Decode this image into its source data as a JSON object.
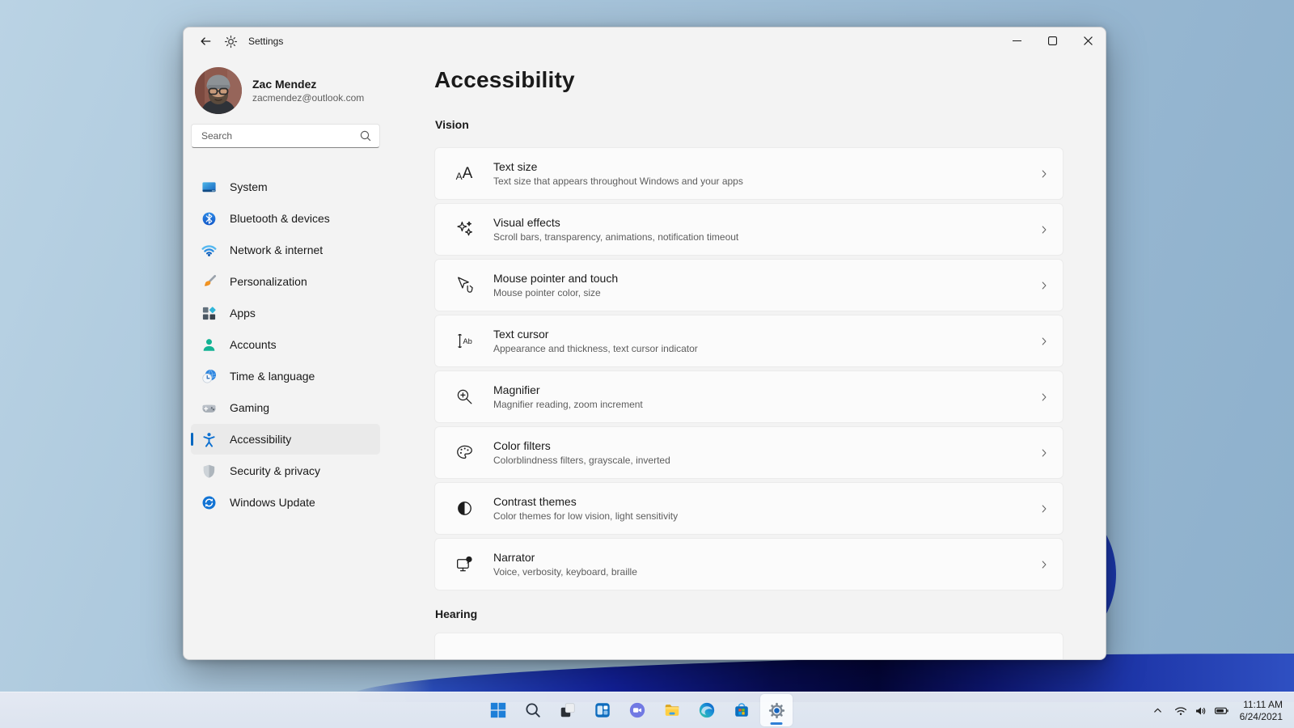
{
  "titlebar": {
    "app_title": "Settings",
    "icons": [
      "back-arrow-icon",
      "settings-gear-icon",
      "minimize-icon",
      "maximize-icon",
      "close-icon"
    ]
  },
  "profile": {
    "name": "Zac Mendez",
    "email": "zacmendez@outlook.com",
    "avatar": "user-photo"
  },
  "search": {
    "placeholder": "Search",
    "icon": "search-icon"
  },
  "sidebar": {
    "items": [
      {
        "label": "System",
        "icon": "system-icon",
        "selected": false
      },
      {
        "label": "Bluetooth & devices",
        "icon": "bluetooth-icon",
        "selected": false
      },
      {
        "label": "Network & internet",
        "icon": "network-icon",
        "selected": false
      },
      {
        "label": "Personalization",
        "icon": "personalization-icon",
        "selected": false
      },
      {
        "label": "Apps",
        "icon": "apps-icon",
        "selected": false
      },
      {
        "label": "Accounts",
        "icon": "accounts-icon",
        "selected": false
      },
      {
        "label": "Time & language",
        "icon": "time-language-icon",
        "selected": false
      },
      {
        "label": "Gaming",
        "icon": "gaming-icon",
        "selected": false
      },
      {
        "label": "Accessibility",
        "icon": "accessibility-icon",
        "selected": true
      },
      {
        "label": "Security & privacy",
        "icon": "security-icon",
        "selected": false
      },
      {
        "label": "Windows Update",
        "icon": "windows-update-icon",
        "selected": false
      }
    ]
  },
  "page": {
    "title": "Accessibility",
    "vision_heading": "Vision",
    "hearing_heading": "Hearing",
    "cards": [
      {
        "title": "Text size",
        "subtitle": "Text size that appears throughout Windows and your apps",
        "icon": "text-size-icon"
      },
      {
        "title": "Visual effects",
        "subtitle": "Scroll bars, transparency, animations, notification timeout",
        "icon": "visual-effects-icon"
      },
      {
        "title": "Mouse pointer and touch",
        "subtitle": "Mouse pointer color, size",
        "icon": "mouse-pointer-icon"
      },
      {
        "title": "Text cursor",
        "subtitle": "Appearance and thickness, text cursor indicator",
        "icon": "text-cursor-icon"
      },
      {
        "title": "Magnifier",
        "subtitle": "Magnifier reading, zoom increment",
        "icon": "magnifier-icon"
      },
      {
        "title": "Color filters",
        "subtitle": "Colorblindness filters, grayscale, inverted",
        "icon": "color-filters-icon"
      },
      {
        "title": "Contrast themes",
        "subtitle": "Color themes for low vision, light sensitivity",
        "icon": "contrast-themes-icon"
      },
      {
        "title": "Narrator",
        "subtitle": "Voice, verbosity, keyboard, braille",
        "icon": "narrator-icon"
      }
    ]
  },
  "taskbar": {
    "buttons": [
      "start",
      "search",
      "task-view",
      "widgets",
      "chat",
      "file-explorer",
      "edge",
      "store",
      "settings"
    ],
    "active_button": "settings"
  },
  "tray": {
    "icons": [
      "hidden-icons-chevron",
      "wifi",
      "volume",
      "battery"
    ],
    "time": "11:11 AM",
    "date": "6/24/2021"
  },
  "colors": {
    "accent": "#0067c0",
    "window_bg": "#f3f3f3",
    "card_bg": "#fbfbfb",
    "bloom_dark_blue": "#070c52"
  }
}
